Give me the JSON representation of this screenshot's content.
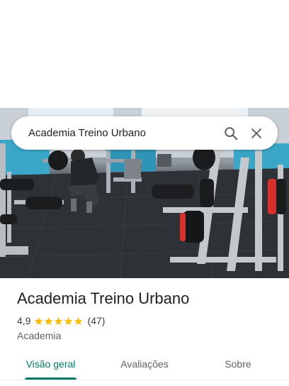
{
  "search": {
    "query": "Academia Treino Urbano"
  },
  "place": {
    "name": "Academia Treino Urbano",
    "rating": "4,9",
    "rating_value": 4.9,
    "stars_filled": 5,
    "review_count": "(47)",
    "category": "Academia"
  },
  "tabs": [
    {
      "label": "Visão geral",
      "active": true
    },
    {
      "label": "Avaliações",
      "active": false
    },
    {
      "label": "Sobre",
      "active": false
    }
  ],
  "colors": {
    "accent": "#00796b",
    "star": "#fbbc04",
    "icon": "#5f6368"
  },
  "icons": {
    "search": "search-icon",
    "close": "close-icon",
    "star": "star-icon"
  }
}
